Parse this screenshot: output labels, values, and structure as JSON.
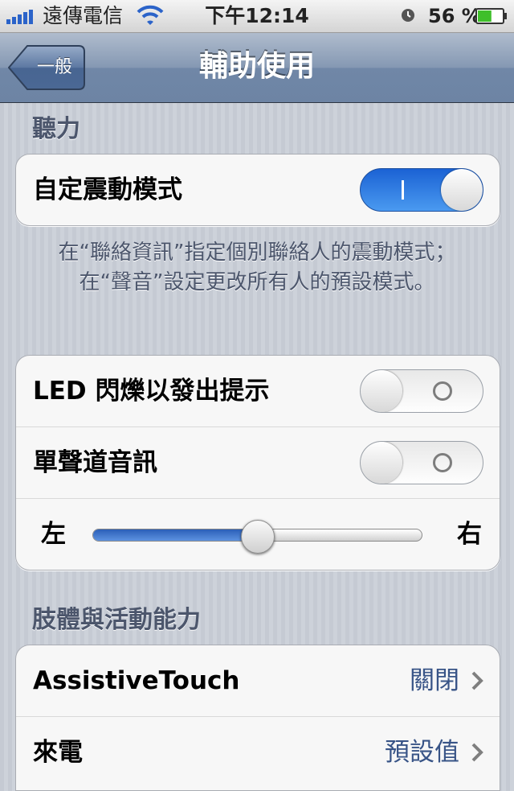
{
  "status_bar": {
    "carrier": "遠傳電信",
    "time": "下午12:14",
    "battery": "56 %",
    "battery_level": 0.56
  },
  "nav": {
    "back_label": "一般",
    "title": "輔助使用"
  },
  "hearing": {
    "header": "聽力",
    "custom_vibration_label": "自定震動模式",
    "custom_vibration_on": true,
    "footer": "在“聯絡資訊”指定個別聯絡人的震動模式；在“聲音”設定更改所有人的預設模式。",
    "led_flash_label": "LED 閃爍以發出提示",
    "led_flash_on": false,
    "mono_audio_label": "單聲道音訊",
    "mono_audio_on": false,
    "balance_left": "左",
    "balance_right": "右",
    "balance_value": 0.5
  },
  "physical": {
    "header": "肢體與活動能力",
    "assistive_touch_label": "AssistiveTouch",
    "assistive_touch_value": "關閉",
    "incoming_call_label": "來電",
    "incoming_call_value": "預設值"
  },
  "colors": {
    "accent": "#2b63c9",
    "value_text": "#385487"
  }
}
